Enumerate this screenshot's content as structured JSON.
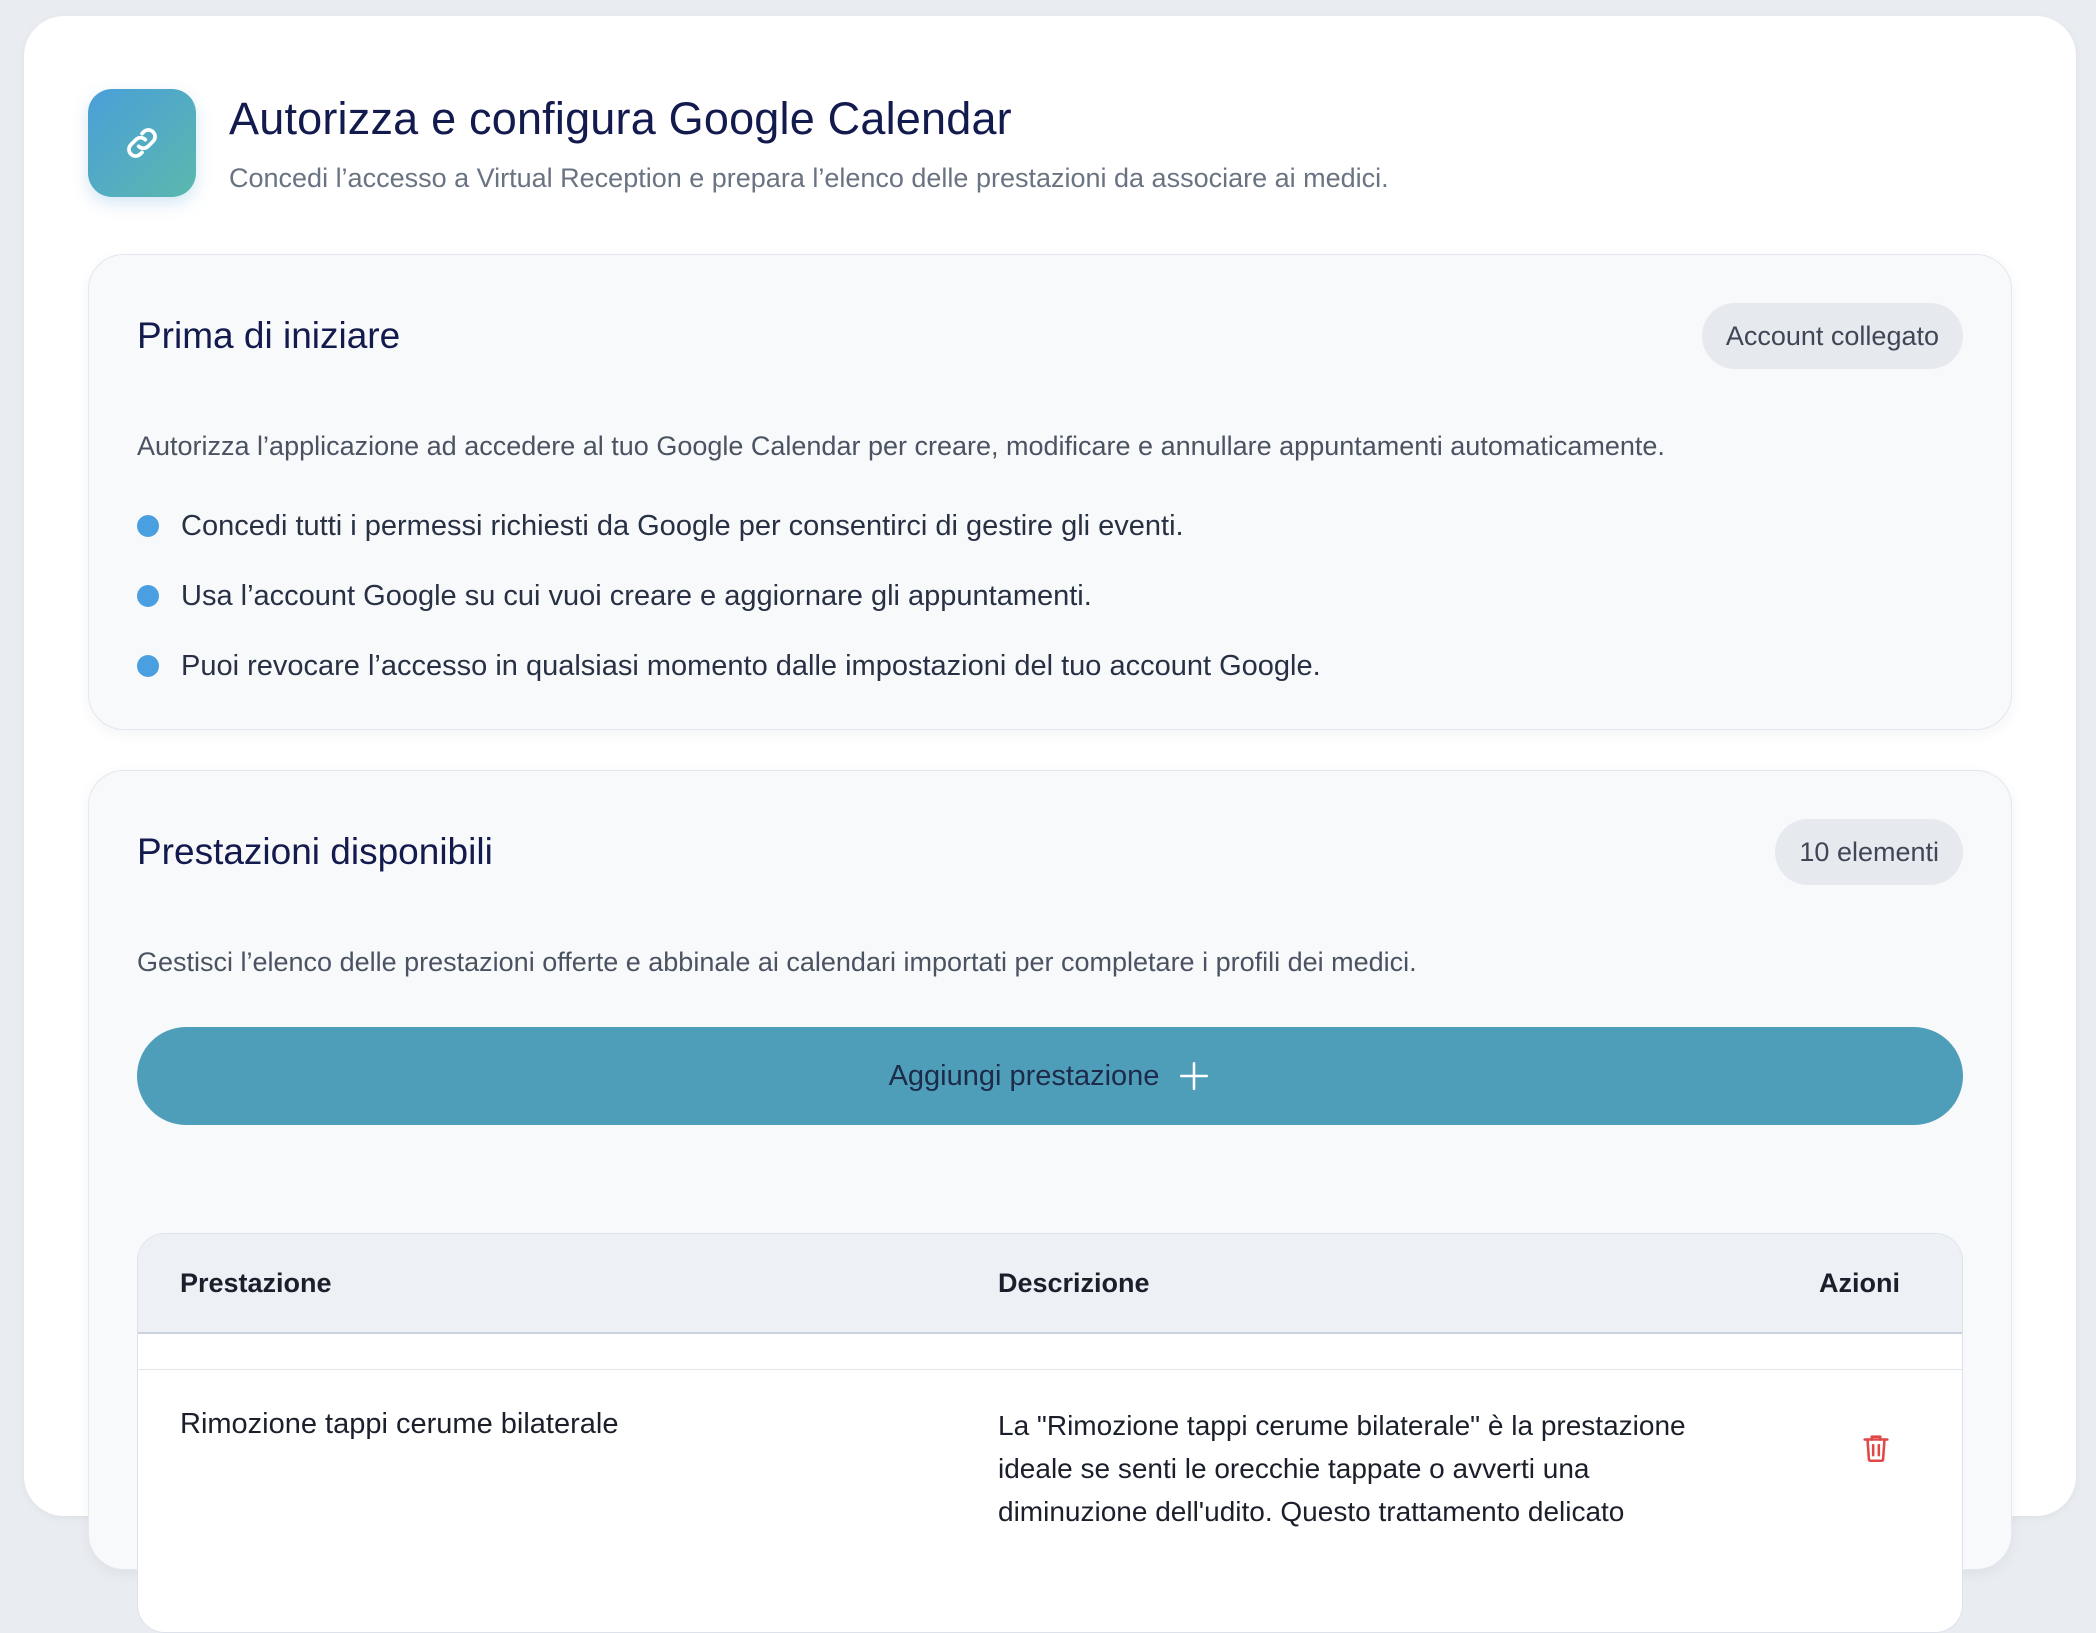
{
  "header": {
    "title": "Autorizza e configura Google Calendar",
    "subtitle": "Concedi l’accesso a Virtual Reception e prepara l’elenco delle prestazioni da associare ai medici.",
    "icon": "link-icon"
  },
  "prerequisites": {
    "title": "Prima di iniziare",
    "badge": "Account collegato",
    "description": "Autorizza l’applicazione ad accedere al tuo Google Calendar per creare, modificare e annullare appuntamenti automaticamente.",
    "bullets": [
      "Concedi tutti i permessi richiesti da Google per consentirci di gestire gli eventi.",
      "Usa l’account Google su cui vuoi creare e aggiornare gli appuntamenti.",
      "Puoi revocare l’accesso in qualsiasi momento dalle impostazioni del tuo account Google."
    ]
  },
  "services": {
    "title": "Prestazioni disponibili",
    "badge": "10 elementi",
    "description": "Gestisci l’elenco delle prestazioni offerte e abbinale ai calendari importati per completare i profili dei medici.",
    "add_button": "Aggiungi prestazione",
    "table": {
      "columns": [
        "Prestazione",
        "Descrizione",
        "Azioni"
      ],
      "rows": [
        {
          "name": "Rimozione tappi cerume bilaterale",
          "description": "La \"Rimozione tappi cerume bilaterale\" è la prestazione ideale se senti le orecchie tappate o avverti una diminuzione dell'udito. Questo trattamento delicato",
          "action_icon": "trash-icon"
        }
      ]
    }
  },
  "colors": {
    "accent": "#4a9fe0",
    "button": "#4f9eb9",
    "danger": "#e04848",
    "title": "#131a4d"
  }
}
